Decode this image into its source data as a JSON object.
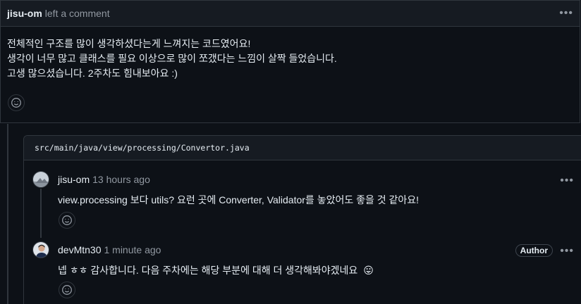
{
  "top_comment": {
    "author": "jisu-om",
    "action": "left a comment",
    "lines": [
      "전체적인 구조를 많이 생각하셨다는게 느껴지는 코드였어요!",
      "생각이 너무 많고 클래스를 필요 이상으로 많이 쪼갰다는 느낌이 살짝 들었습니다.",
      "고생 많으셨습니다. 2주차도 힘내보아요 :)"
    ],
    "more_icon": "kebab-horizontal-icon",
    "reaction_icon": "smiley-icon"
  },
  "file_thread": {
    "path": "src/main/java/view/processing/Convertor.java",
    "replies": [
      {
        "author": "jisu-om",
        "time": "13 hours ago",
        "text": "view.processing 보다 utils? 요런 곳에 Converter, Validator를 놓았어도 좋을 것 같아요!",
        "badge": ""
      },
      {
        "author": "devMtn30",
        "time": "1 minute ago",
        "text": "넵 ㅎㅎ 감사합니다. 다음 주차에는 해당 부분에 대해 더 생각해봐야겠네요",
        "badge": "Author",
        "emoji": "😛"
      }
    ]
  },
  "colors": {
    "background": "#0d1117",
    "header": "#161b22",
    "border": "#30363d",
    "text": "#e6edf3",
    "muted": "#9198a1"
  }
}
